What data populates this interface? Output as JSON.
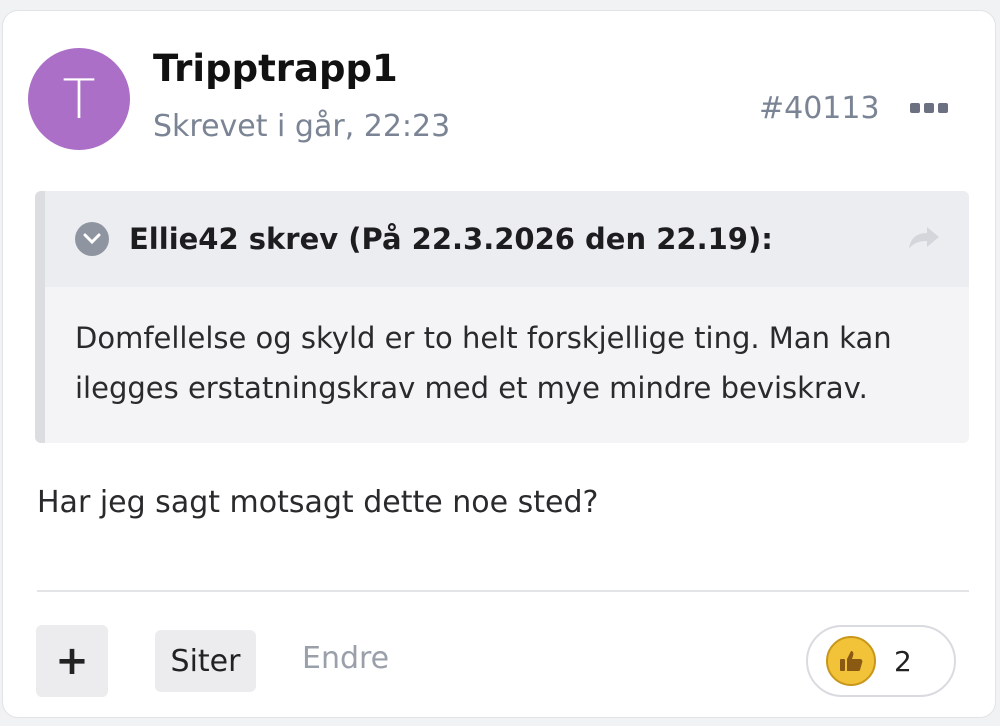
{
  "post": {
    "avatar_letter": "T",
    "author": "Tripptrapp1",
    "timestamp": "Skrevet i går, 22:23",
    "number": "#40113"
  },
  "quote": {
    "header": "Ellie42 skrev (På 22.3.2026 den 22.19):",
    "line1": "Domfellelse og skyld er to helt forskjellige ting. Man kan",
    "line2": "ilegges erstatningskrav med et mye mindre beviskrav."
  },
  "reply": {
    "text": "Har jeg sagt motsagt dette noe sted?"
  },
  "actions": {
    "add_label": "+",
    "quote_label": "Siter",
    "edit_label": "Endre",
    "reaction_count": "2"
  },
  "colors": {
    "avatar": "#ab6fc7",
    "muted_text": "#7b8494",
    "reaction_badge": "#f2c339"
  },
  "icons": [
    "chevron-down-icon",
    "reply-arrow-icon",
    "more-icon",
    "thumbs-up-icon"
  ]
}
